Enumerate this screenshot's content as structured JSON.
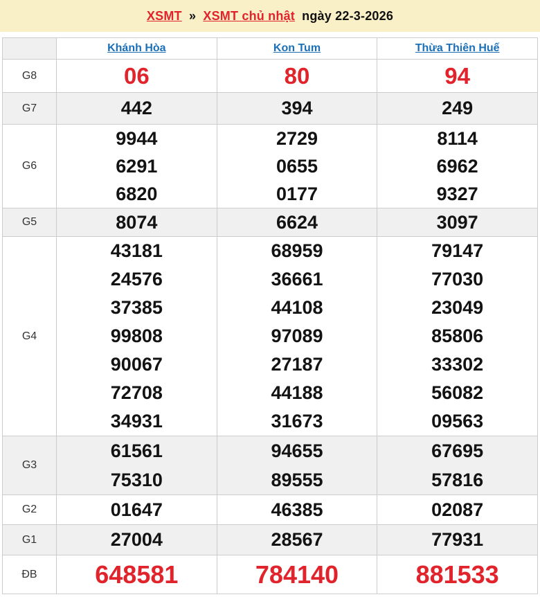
{
  "colors": {
    "banner_bg": "#faf0c8",
    "accent_red": "#e1232b",
    "link_blue": "#1b6fb7",
    "row_alt_bg": "#f0f0f0",
    "border": "#cccccc",
    "number_black": "#131313"
  },
  "title": {
    "region_link": "XSMT",
    "separator": "»",
    "day_link": "XSMT chủ nhật",
    "date_text": "ngày 22-3-2026"
  },
  "table": {
    "provinces": [
      "Khánh Hòa",
      "Kon Tum",
      "Thừa Thiên Huế"
    ],
    "rows": [
      {
        "label": "G8",
        "highlight": true,
        "values": [
          [
            "06"
          ],
          [
            "80"
          ],
          [
            "94"
          ]
        ]
      },
      {
        "label": "G7",
        "highlight": false,
        "values": [
          [
            "442"
          ],
          [
            "394"
          ],
          [
            "249"
          ]
        ]
      },
      {
        "label": "G6",
        "highlight": false,
        "values": [
          [
            "9944",
            "6291",
            "6820"
          ],
          [
            "2729",
            "0655",
            "0177"
          ],
          [
            "8114",
            "6962",
            "9327"
          ]
        ]
      },
      {
        "label": "G5",
        "highlight": false,
        "values": [
          [
            "8074"
          ],
          [
            "6624"
          ],
          [
            "3097"
          ]
        ]
      },
      {
        "label": "G4",
        "highlight": false,
        "values": [
          [
            "43181",
            "24576",
            "37385",
            "99808",
            "90067",
            "72708",
            "34931"
          ],
          [
            "68959",
            "36661",
            "44108",
            "97089",
            "27187",
            "44188",
            "31673"
          ],
          [
            "79147",
            "77030",
            "23049",
            "85806",
            "33302",
            "56082",
            "09563"
          ]
        ]
      },
      {
        "label": "G3",
        "highlight": false,
        "values": [
          [
            "61561",
            "75310"
          ],
          [
            "94655",
            "89555"
          ],
          [
            "67695",
            "57816"
          ]
        ]
      },
      {
        "label": "G2",
        "highlight": false,
        "values": [
          [
            "01647"
          ],
          [
            "46385"
          ],
          [
            "02087"
          ]
        ]
      },
      {
        "label": "G1",
        "highlight": false,
        "values": [
          [
            "27004"
          ],
          [
            "28567"
          ],
          [
            "77931"
          ]
        ]
      },
      {
        "label": "ĐB",
        "highlight": true,
        "values": [
          [
            "648581"
          ],
          [
            "784140"
          ],
          [
            "881533"
          ]
        ]
      }
    ]
  }
}
